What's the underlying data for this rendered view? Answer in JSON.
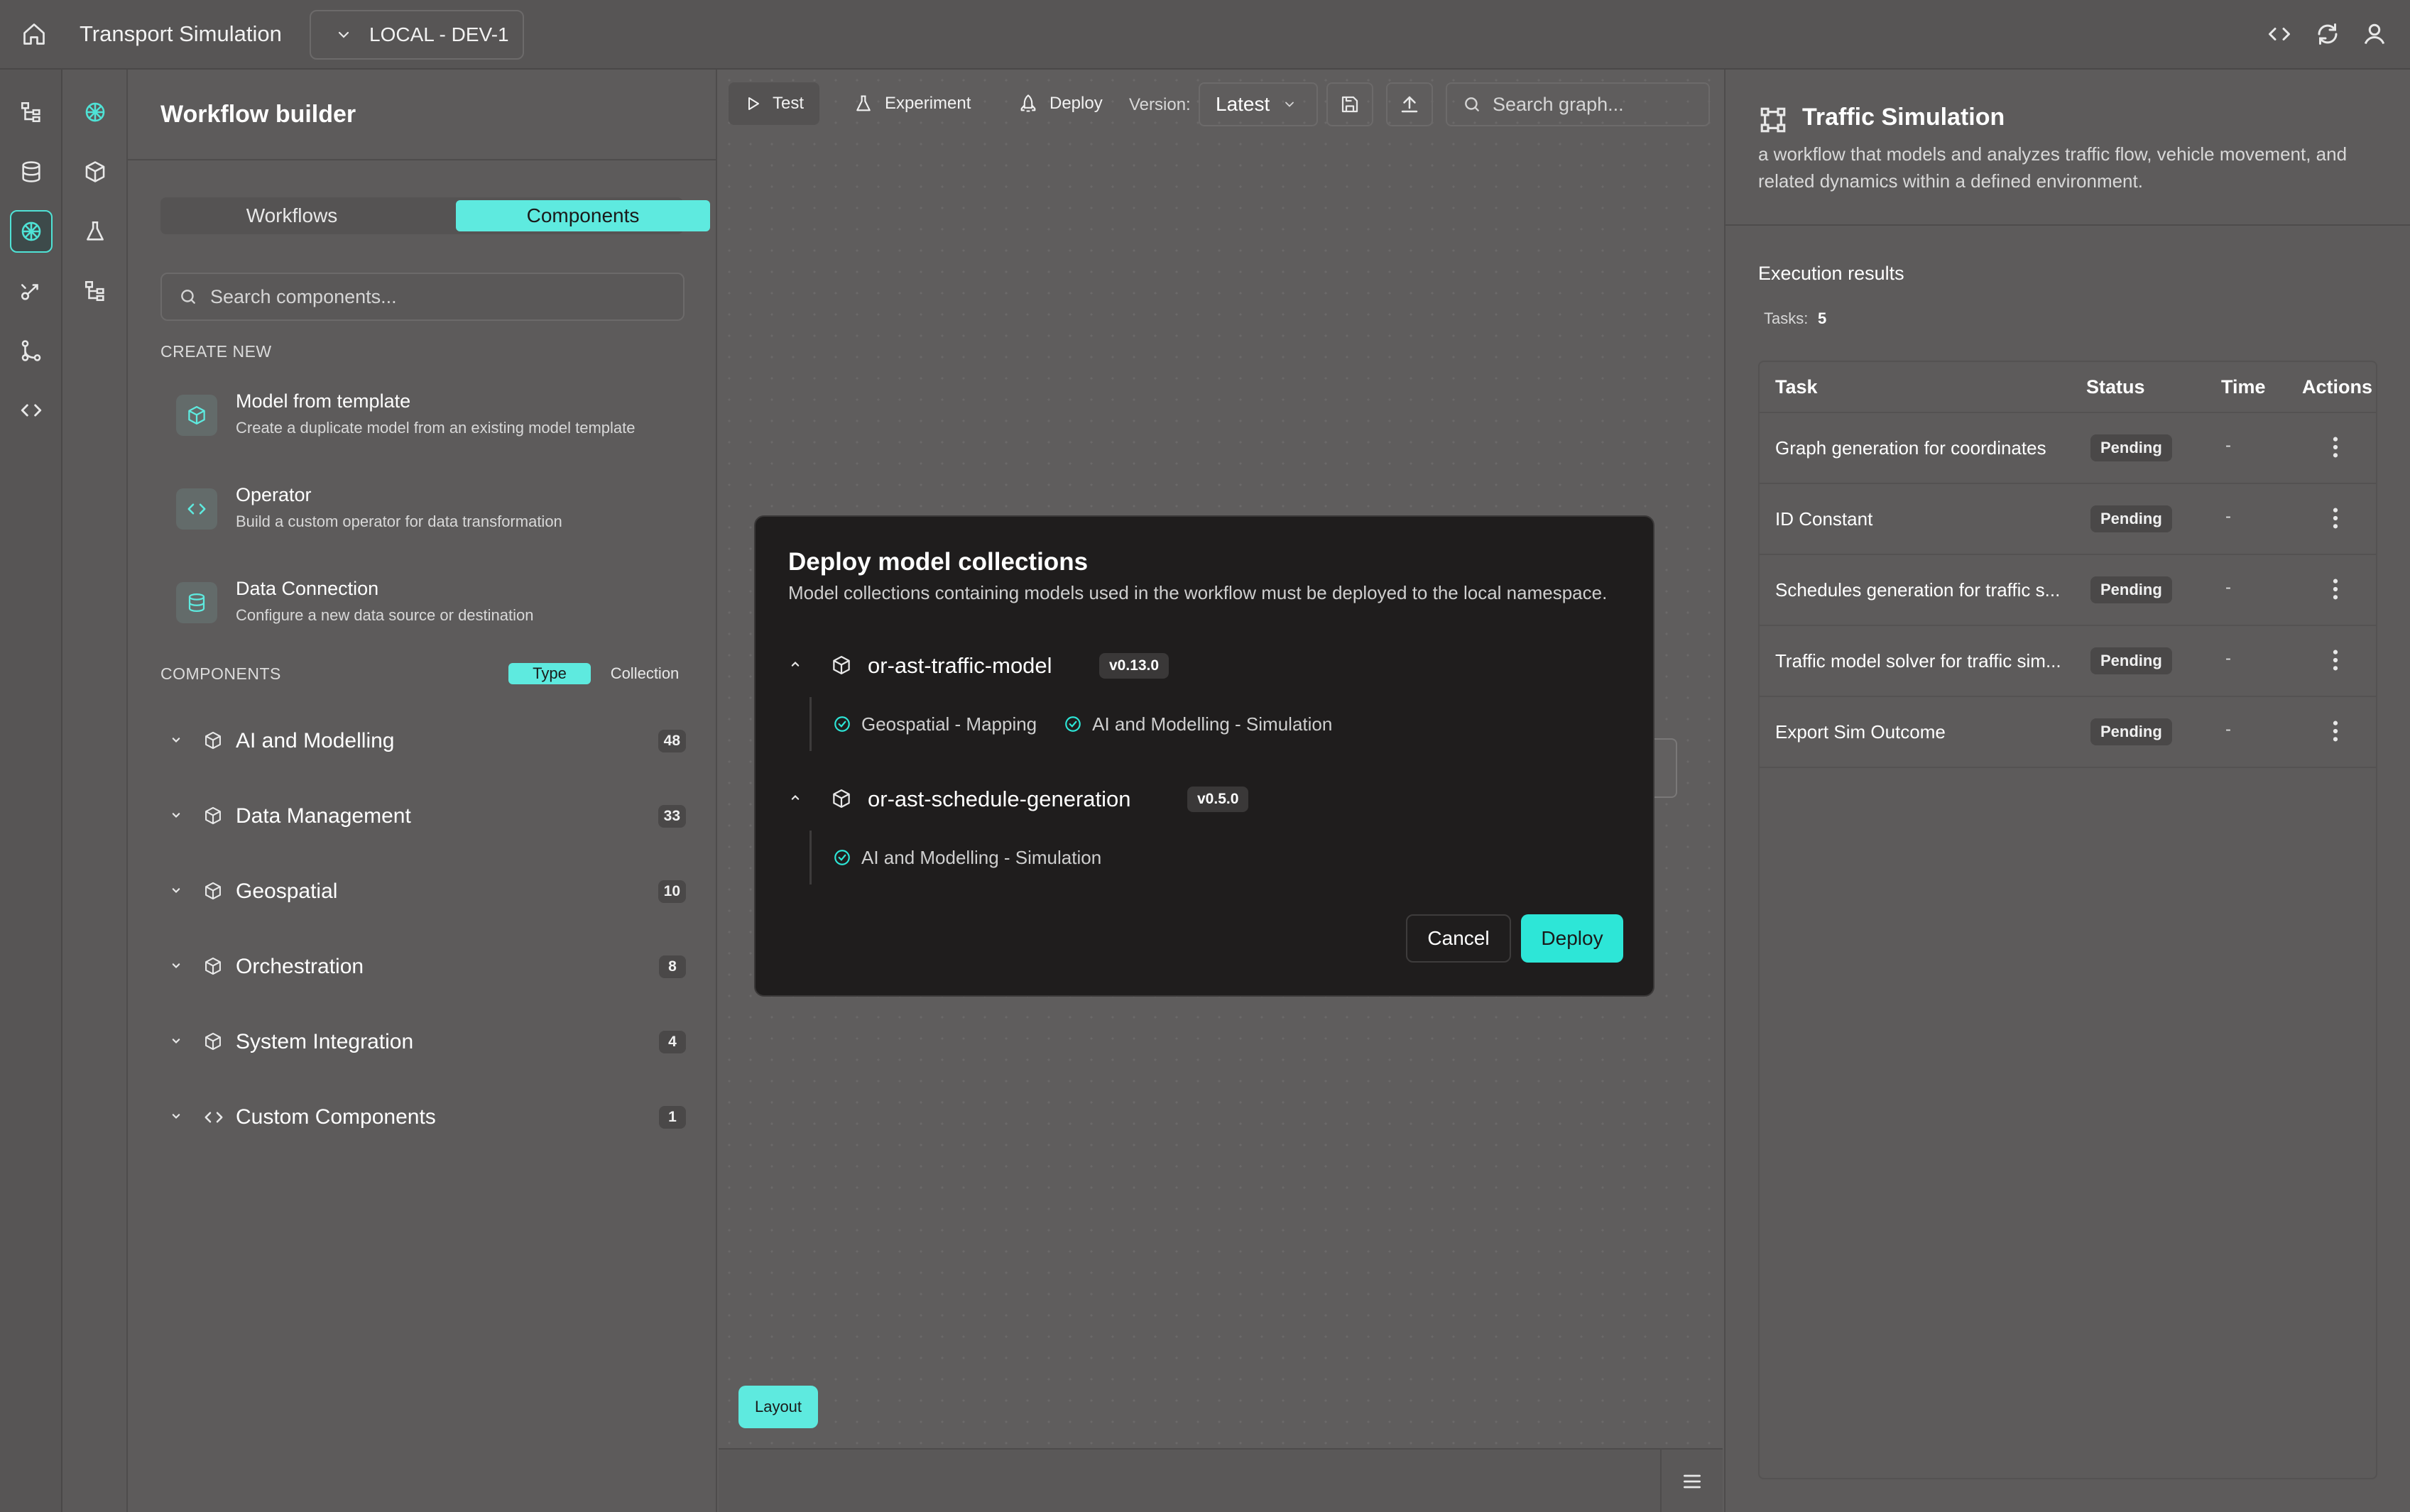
{
  "topbar": {
    "app_title": "Transport Simulation",
    "environment": "LOCAL - DEV-1",
    "icons": [
      "home-icon",
      "chevron-down-icon",
      "code-icon",
      "refresh-icon",
      "user-icon"
    ]
  },
  "rail_primary": {
    "items": [
      "hierarchy-icon",
      "database-icon",
      "brain-icon",
      "connector-icon",
      "git-branch-icon",
      "code-icon"
    ],
    "active": "brain-icon"
  },
  "rail_secondary": {
    "items": [
      "brain-icon",
      "cube-icon",
      "flask-icon",
      "hierarchy-icon"
    ],
    "active": "brain-icon"
  },
  "left_panel": {
    "title": "Workflow builder",
    "tabs": [
      {
        "label": "Workflows",
        "active": false
      },
      {
        "label": "Components",
        "active": true
      }
    ],
    "search_placeholder": "Search components...",
    "create_new_label": "CREATE NEW",
    "create_items": [
      {
        "title": "Model from template",
        "description": "Create a duplicate model from an existing model template",
        "icon": "cube-icon"
      },
      {
        "title": "Operator",
        "description": "Build a custom operator for data transformation",
        "icon": "code-icon"
      },
      {
        "title": "Data Connection",
        "description": "Configure a new data source or destination",
        "icon": "database-icon"
      }
    ],
    "components_label": "COMPONENTS",
    "group_toggle": {
      "type": "Type",
      "collection": "Collection",
      "active": "Type"
    },
    "categories": [
      {
        "label": "AI and Modelling",
        "count": "48",
        "icon": "cube-icon"
      },
      {
        "label": "Data Management",
        "count": "33",
        "icon": "cube-icon"
      },
      {
        "label": "Geospatial",
        "count": "10",
        "icon": "cube-icon"
      },
      {
        "label": "Orchestration",
        "count": "8",
        "icon": "cube-icon"
      },
      {
        "label": "System Integration",
        "count": "4",
        "icon": "cube-icon"
      },
      {
        "label": "Custom Components",
        "count": "1",
        "icon": "code-icon"
      }
    ]
  },
  "toolbar": {
    "test": "Test",
    "experiment": "Experiment",
    "deploy": "Deploy",
    "version_label": "Version:",
    "version_value": "Latest",
    "search_placeholder": "Search graph...",
    "layout": "Layout"
  },
  "modal": {
    "title": "Deploy model collections",
    "description": "Model collections containing models used in the workflow must be deployed to the local namespace.",
    "collections": [
      {
        "name": "or-ast-traffic-model",
        "version": "v0.13.0",
        "tags": [
          "Geospatial - Mapping",
          "AI and Modelling - Simulation"
        ]
      },
      {
        "name": "or-ast-schedule-generation",
        "version": "v0.5.0",
        "tags": [
          "AI and Modelling - Simulation"
        ]
      }
    ],
    "cancel": "Cancel",
    "deploy": "Deploy",
    "accent_color": "#2de6d7"
  },
  "right_panel": {
    "title": "Traffic Simulation",
    "description": "a workflow that models and analyzes traffic flow, vehicle movement, and related dynamics within a defined environment.",
    "execution_title": "Execution results",
    "tasks_label": "Tasks:",
    "tasks_count": "5",
    "columns": [
      "Task",
      "Status",
      "Time",
      "Actions"
    ],
    "rows": [
      {
        "task": "Graph generation for coordinates",
        "status": "Pending",
        "time": "-"
      },
      {
        "task": "ID Constant",
        "status": "Pending",
        "time": "-"
      },
      {
        "task": "Schedules generation for traffic s...",
        "status": "Pending",
        "time": "-"
      },
      {
        "task": "Traffic model solver for traffic sim...",
        "status": "Pending",
        "time": "-"
      },
      {
        "task": "Export Sim Outcome",
        "status": "Pending",
        "time": "-"
      }
    ]
  }
}
